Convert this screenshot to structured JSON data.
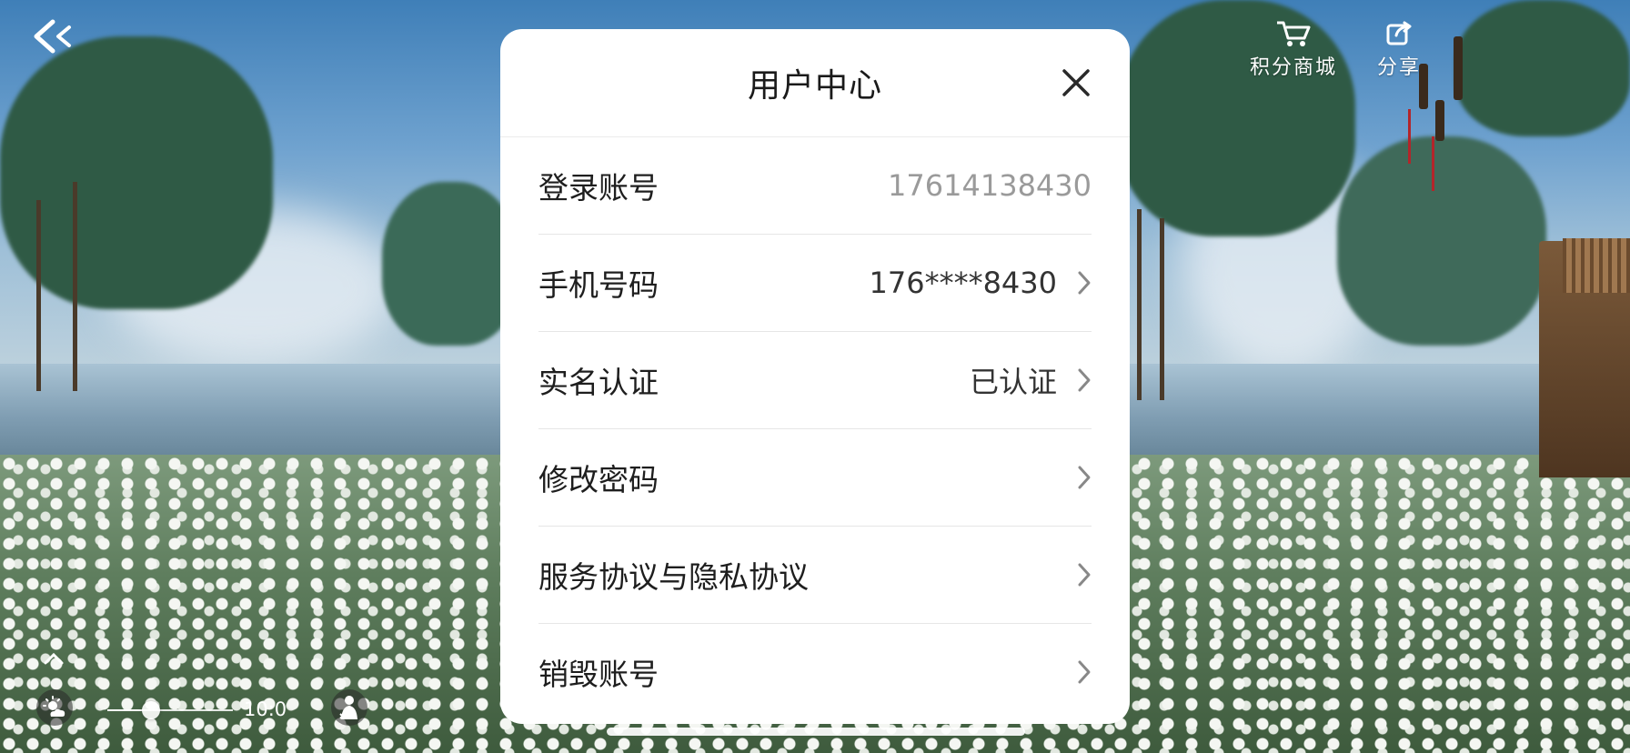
{
  "hud": {
    "back_icon": "back-arrow-icon",
    "points_mall": {
      "label": "积分商城",
      "icon": "cart-icon"
    },
    "share": {
      "label": "分享",
      "icon": "share-icon"
    },
    "time_label": "10:0",
    "time_slider_fraction": 0.35
  },
  "modal": {
    "title": "用户中心",
    "close_icon": "close-icon",
    "rows": [
      {
        "label": "登录账号",
        "value": "17614138430"
      },
      {
        "label": "手机号码",
        "value": "176****8430"
      },
      {
        "label": "实名认证",
        "value": "已认证"
      },
      {
        "label": "修改密码",
        "value": ""
      },
      {
        "label": "服务协议与隐私协议",
        "value": ""
      },
      {
        "label": "销毁账号",
        "value": ""
      }
    ]
  },
  "colors": {
    "modal_bg": "#ffffff",
    "muted_value": "#9a9a9a",
    "tassel": "#b3252a"
  }
}
